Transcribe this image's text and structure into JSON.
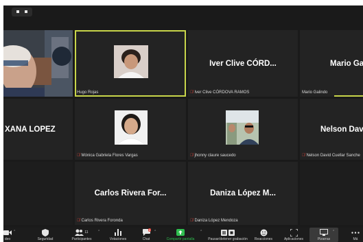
{
  "view": {
    "dots": "::"
  },
  "tiles": [
    {
      "id": "self-video",
      "big_name": "",
      "label": ""
    },
    {
      "id": "hugo",
      "big_name": "",
      "label": "Hugo Rojas",
      "muted": false
    },
    {
      "id": "iver",
      "big_name": "Iver Clive CÓRD...",
      "label": "Iver Clive CÓRDOVA RAMOS",
      "muted": true
    },
    {
      "id": "mario",
      "big_name": "Mario Gali",
      "label": "Mario Galindo",
      "muted": false
    },
    {
      "id": "roxana",
      "big_name": "XANA LOPEZ",
      "label": "",
      "muted": false
    },
    {
      "id": "monica",
      "big_name": "",
      "label": "Mónica Gabriela Flores Vargas",
      "muted": true
    },
    {
      "id": "jhonny",
      "big_name": "",
      "label": "jhonny claure saucedo",
      "muted": true
    },
    {
      "id": "nelson",
      "big_name": "Nelson Davi",
      "label": "Nelson David Cuellar Sanche",
      "muted": true
    },
    {
      "id": "carlos",
      "big_name": "Carlos Rivera For...",
      "label": "Carlos Rivera Foronda",
      "muted": true
    },
    {
      "id": "daniza",
      "big_name": "Daniza López M...",
      "label": "Daniza López Mendoza",
      "muted": true
    }
  ],
  "toolbar": {
    "items": [
      {
        "id": "video",
        "label": "deo",
        "icon": "video-icon"
      },
      {
        "id": "security",
        "label": "Seguridad",
        "icon": "shield-icon"
      },
      {
        "id": "participants",
        "label": "Participantes",
        "icon": "participants-icon",
        "count": "11"
      },
      {
        "id": "polls",
        "label": "Votaciones",
        "icon": "bar-chart-icon"
      },
      {
        "id": "chat",
        "label": "Chat",
        "icon": "chat-icon",
        "badge": "6"
      },
      {
        "id": "share",
        "label": "Compartir pantalla",
        "icon": "share-screen-icon"
      },
      {
        "id": "record",
        "label": "Pausar/detener grabación",
        "icon": "record-icon"
      },
      {
        "id": "reactions",
        "label": "Reacciones",
        "icon": "smiley-icon"
      },
      {
        "id": "apps",
        "label": "Aplicaciones",
        "icon": "apps-icon"
      },
      {
        "id": "whiteboards",
        "label": "Pizarras",
        "icon": "whiteboard-icon"
      },
      {
        "id": "more",
        "label": "Má",
        "icon": "more-icon"
      }
    ]
  },
  "colors": {
    "active_border": "#c9d64a",
    "muted_red": "#e0463c",
    "share_green": "#2fbf4f"
  }
}
